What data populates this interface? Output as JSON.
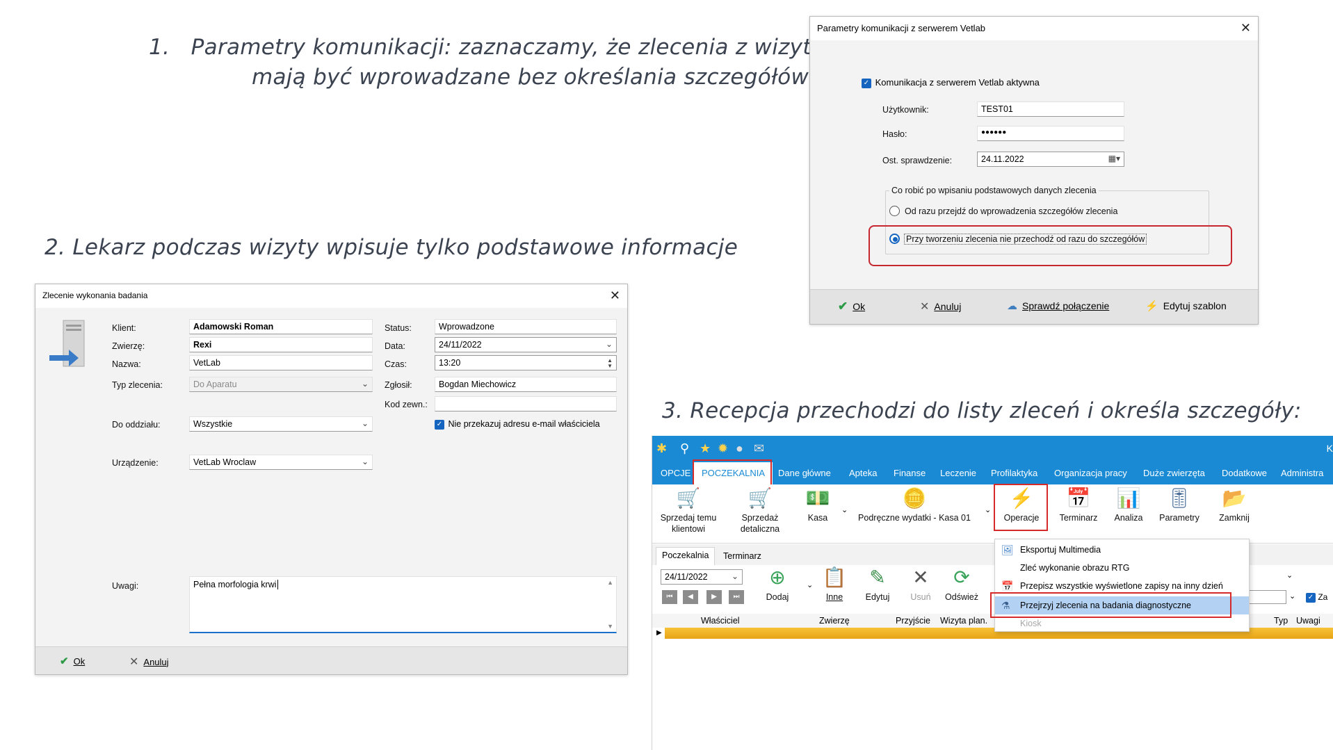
{
  "headings": {
    "step1_number": "1.",
    "step1_line1": "Parametry komunikacji: zaznaczamy, że zlecenia z wizyty",
    "step1_line2": "mają być wprowadzane bez określania szczegółów:",
    "step2": "2. Lekarz podczas wizyty wpisuje tylko podstawowe informacje",
    "step3": "3. Recepcja przechodzi do listy zleceń i określa szczegóły:"
  },
  "dialog_params": {
    "title": "Parametry komunikacji z serwerem Vetlab",
    "active_checkbox_label": "Komunikacja z serwerem Vetlab aktywna",
    "user_label": "Użytkownik:",
    "user_value": "TEST01",
    "password_label": "Hasło:",
    "password_value": "●●●●●●",
    "last_check_label": "Ost. sprawdzenie:",
    "last_check_value": "24.11.2022",
    "group_title": "Co robić po wpisaniu podstawowych danych zlecenia",
    "option1": "Od razu przejdź do wprowadzenia szczegółów zlecenia",
    "option2": "Przy tworzeniu zlecenia nie przechodź od razu do szczegółów",
    "selected_option": 2,
    "ok": "Ok",
    "cancel": "Anuluj",
    "check_connection": "Sprawdź połączenie",
    "edit_template": "Edytuj szablon"
  },
  "dialog_order": {
    "title": "Zlecenie wykonania badania",
    "client_label": "Klient:",
    "client_value": "Adamowski Roman",
    "animal_label": "Zwierzę:",
    "animal_value": "Rexi",
    "name_label": "Nazwa:",
    "name_value": "VetLab",
    "type_label": "Typ zlecenia:",
    "type_value": "Do Aparatu",
    "dept_label": "Do oddziału:",
    "dept_value": "Wszystkie",
    "device_label": "Urządzenie:",
    "device_value": "VetLab Wroclaw",
    "status_label": "Status:",
    "status_value": "Wprowadzone",
    "date_label": "Data:",
    "date_value": "24/11/2022",
    "time_label": "Czas:",
    "time_value": "13:20",
    "reported_label": "Zgłosił:",
    "reported_value": "Bogdan Miechowicz",
    "ext_code_label": "Kod zewn.:",
    "ext_code_value": "",
    "no_email_label": "Nie przekazuj adresu e-mail właściciela",
    "notes_label": "Uwagi:",
    "notes_value": "Pełna morfologia krwi",
    "ok": "Ok",
    "cancel": "Anuluj"
  },
  "app": {
    "menu_tabs": [
      "OPCJE",
      "POCZEKALNIA",
      "Dane główne",
      "Apteka",
      "Finanse",
      "Leczenie",
      "Profilaktyka",
      "Organizacja pracy",
      "Duże zwierzęta",
      "Dodatkowe",
      "Administra"
    ],
    "active_tab": "POCZEKALNIA",
    "top_right_letter": "K",
    "ribbon": {
      "sell_client": "Sprzedaj temu klientowi",
      "retail": "Sprzedaż detaliczna",
      "cash": "Kasa",
      "petty": "Podręczne wydatki - Kasa 01",
      "operations": "Operacje",
      "schedule": "Terminarz",
      "analysis": "Analiza",
      "params": "Parametry",
      "close": "Zamknij"
    },
    "sub_tabs": [
      "Poczekalnia",
      "Terminarz"
    ],
    "date": "24/11/2022",
    "toolbar": {
      "add": "Dodaj",
      "other": "Inne",
      "edit": "Edytuj",
      "delete": "Usuń",
      "refresh": "Odśwież",
      "za": "Za"
    },
    "columns": [
      "Właściciel",
      "Zwierzę",
      "Przyjście",
      "Wizyta plan.",
      "Typ",
      "Uwagi"
    ],
    "popup": [
      {
        "label": "Eksportuj Multimedia",
        "icon": "multimedia-icon"
      },
      {
        "label": "Zleć wykonanie obrazu RTG",
        "icon": ""
      },
      {
        "label": "Przepisz wszystkie wyświetlone zapisy na inny dzień",
        "icon": "calendar-icon"
      },
      {
        "label": "Przejrzyj zlecenia na badania diagnostyczne",
        "icon": "lab-icon"
      },
      {
        "label": "Kiosk",
        "icon": ""
      }
    ]
  },
  "colors": {
    "accent_blue": "#1a8ad4",
    "highlight_red": "#d62a2a",
    "row_orange": "#f0b12a",
    "ok_green": "#2d9a46"
  }
}
